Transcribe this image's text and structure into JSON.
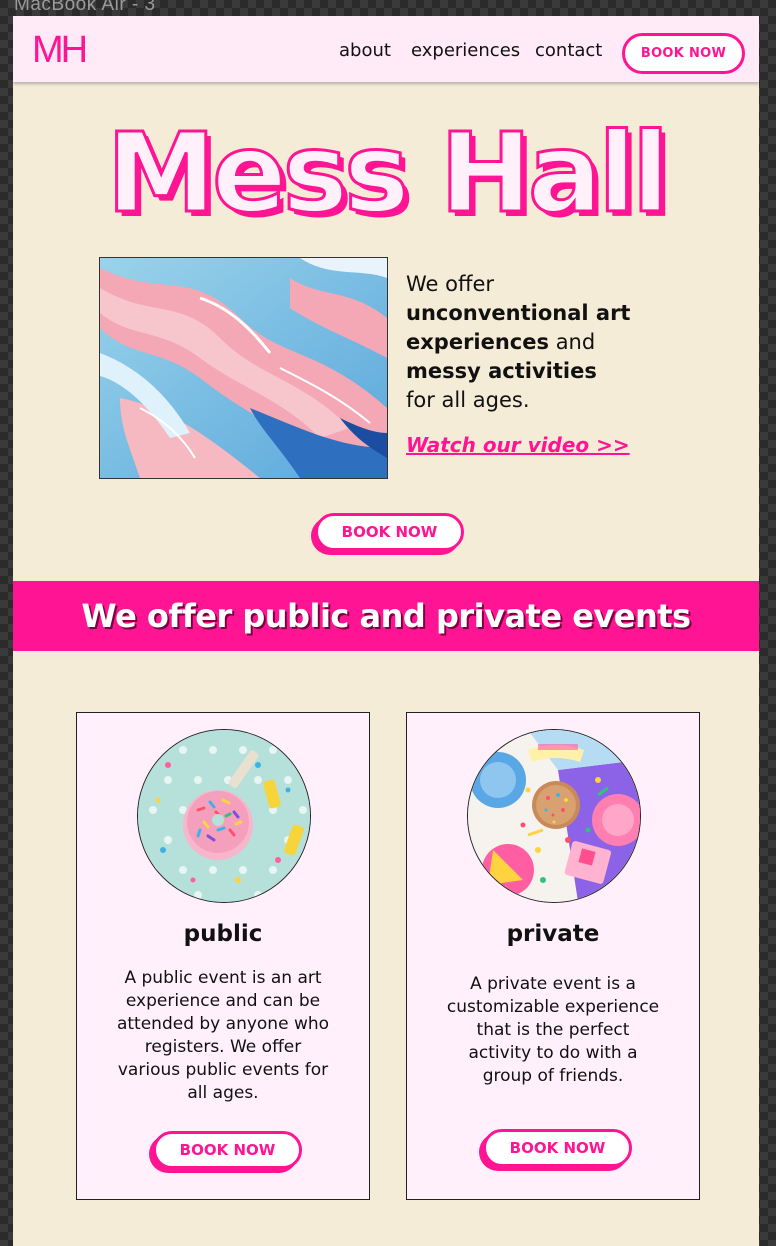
{
  "window": {
    "frame_label": "MacBook Air - 3"
  },
  "nav": {
    "logo": "MH",
    "links": [
      "about",
      "experiences",
      "contact"
    ],
    "cta": "BOOK NOW"
  },
  "hero": {
    "title": "Mess Hall",
    "copy": {
      "p1": "We offer ",
      "b1": "unconventional art experiences",
      "p2": " and ",
      "b2": "messy activities",
      "p3": " for all ages."
    },
    "video_link": "Watch our video >>",
    "cta": "BOOK NOW"
  },
  "banner": {
    "text": "We offer public and private events"
  },
  "cards": [
    {
      "title": "public",
      "description": "A public event is an art experience and can be attended by anyone who registers. We offer various public events for all ages.",
      "cta": "BOOK NOW",
      "image": "donut-party-image"
    },
    {
      "title": "private",
      "description": "A private event is a customizable experience that is the perfect activity to do with a group of friends.",
      "cta": "BOOK NOW",
      "image": "birthday-party-image"
    }
  ],
  "colors": {
    "accent": "#ff1493",
    "page_background": "#f5ecd7",
    "nav_background": "#ffebf7",
    "card_background": "#fff0fb"
  }
}
